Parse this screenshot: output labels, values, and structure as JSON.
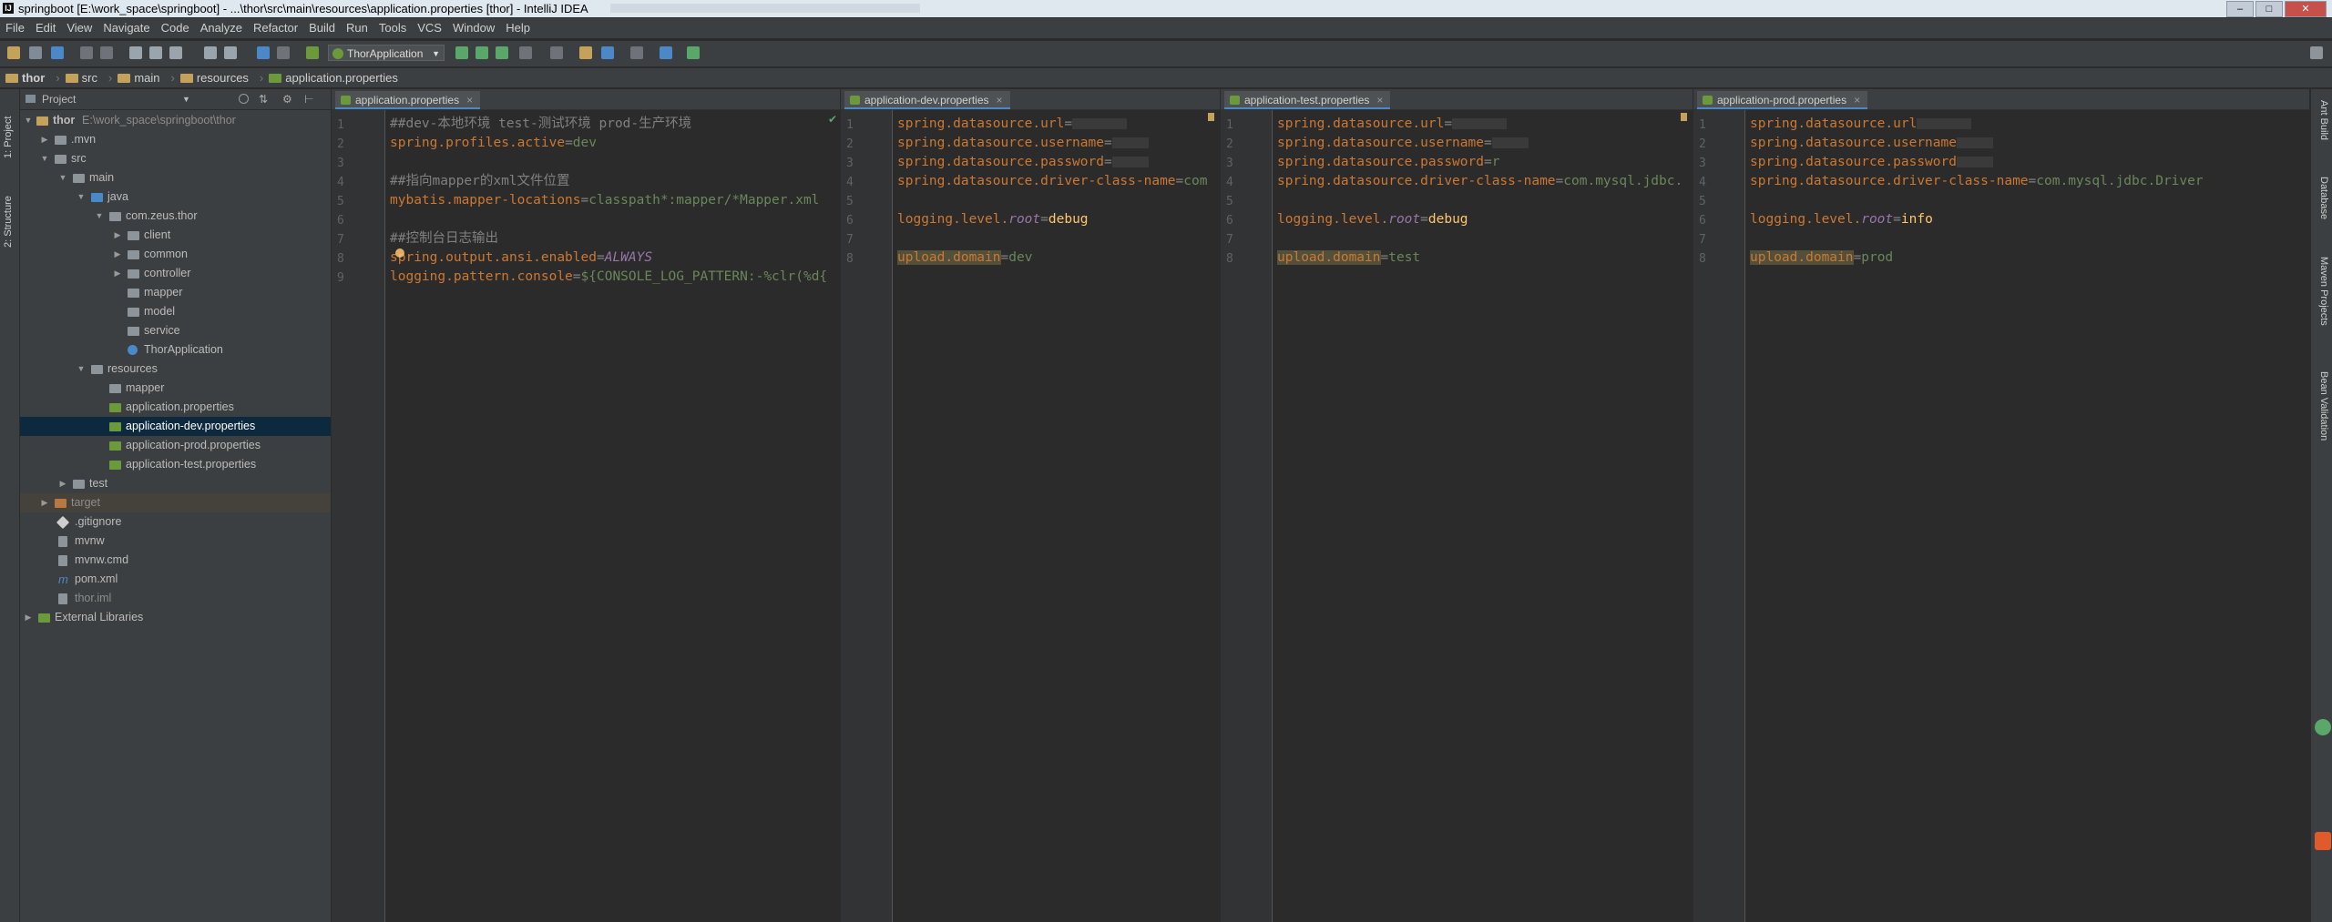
{
  "titlebar": {
    "title": "springboot [E:\\work_space\\springboot] - ...\\thor\\src\\main\\resources\\application.properties [thor] - IntelliJ IDEA"
  },
  "menubar": {
    "items": [
      "File",
      "Edit",
      "View",
      "Navigate",
      "Code",
      "Analyze",
      "Refactor",
      "Build",
      "Run",
      "Tools",
      "VCS",
      "Window",
      "Help"
    ]
  },
  "toolbar": {
    "run_config": "ThorApplication"
  },
  "breadcrumb": [
    "thor",
    "src",
    "main",
    "resources",
    "application.properties"
  ],
  "left_strip": {
    "project": "1: Project",
    "structure": "2: Structure"
  },
  "right_strip": [
    "Ant Build",
    "Database",
    "Maven Projects",
    "Bean Validation"
  ],
  "project_panel": {
    "title": "Project",
    "root_label": "thor",
    "root_path": "E:\\work_space\\springboot\\thor",
    "tree": [
      "thor",
      ".mvn",
      "src",
      "main",
      "java",
      "com.zeus.thor",
      "client",
      "common",
      "controller",
      "mapper",
      "model",
      "service",
      "ThorApplication",
      "resources",
      "mapper",
      "application.properties",
      "application-dev.properties",
      "application-prod.properties",
      "application-test.properties",
      "test",
      "target",
      ".gitignore",
      "mvnw",
      "mvnw.cmd",
      "pom.xml",
      "thor.iml",
      "External Libraries"
    ]
  },
  "editors": [
    {
      "tab": "application.properties",
      "lines": [
        "##dev-本地环境 test-测试环境 prod-生产环境",
        "spring.profiles.active=dev",
        "",
        "##指向mapper的xml文件位置",
        "mybatis.mapper-locations=classpath*:mapper/*Mapper.xml",
        "",
        "##控制台日志输出",
        "spring.output.ansi.enabled=ALWAYS",
        "logging.pattern.console=${CONSOLE_LOG_PATTERN:-%clr(%d{"
      ]
    },
    {
      "tab": "application-dev.properties",
      "lines": [
        "spring.datasource.url=",
        "spring.datasource.username=",
        "spring.datasource.password=",
        "spring.datasource.driver-class-name=com",
        "",
        "logging.level.root=debug",
        "",
        "upload.domain=dev"
      ]
    },
    {
      "tab": "application-test.properties",
      "lines": [
        "spring.datasource.url=",
        "spring.datasource.username=",
        "spring.datasource.password=r",
        "spring.datasource.driver-class-name=com.mysql.jdbc.",
        "",
        "logging.level.root=debug",
        "",
        "upload.domain=test"
      ]
    },
    {
      "tab": "application-prod.properties",
      "lines": [
        "spring.datasource.url",
        "spring.datasource.username",
        "spring.datasource.password",
        "spring.datasource.driver-class-name=com.mysql.jdbc.Driver",
        "",
        "logging.level.root=info",
        "",
        "upload.domain=prod"
      ]
    }
  ],
  "colors": {
    "editor_bg": "#2b2b2b",
    "panel_bg": "#3c3f41",
    "key": "#cc7832",
    "value": "#6a8759",
    "comment": "#808080",
    "selection": "#0d293e"
  }
}
